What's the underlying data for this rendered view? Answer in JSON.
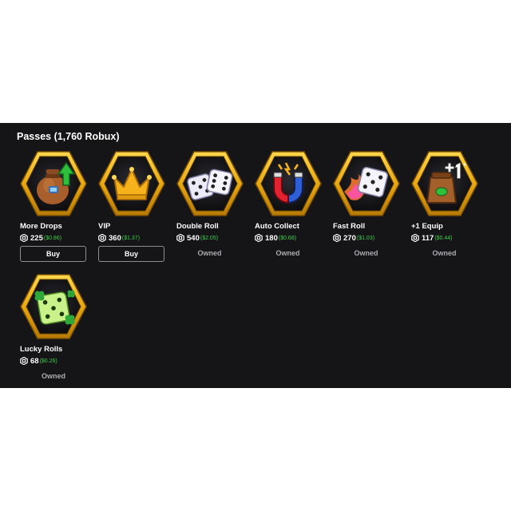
{
  "header": {
    "title": "Passes (1,760 Robux)"
  },
  "colors": {
    "panel_bg": "#151518",
    "gold": "#e8b923",
    "usd_green": "#3ecf4a",
    "owned_gray": "#a9abb0"
  },
  "passes": [
    {
      "name": "More Drops",
      "amount": "225",
      "usd": "($0.86)",
      "status": "Buy",
      "icon": "money-bag-arrow-icon"
    },
    {
      "name": "VIP",
      "amount": "360",
      "usd": "($1.37)",
      "status": "Buy",
      "icon": "crown-icon"
    },
    {
      "name": "Double Roll",
      "amount": "540",
      "usd": "($2.05)",
      "status": "Owned",
      "icon": "two-dice-icon"
    },
    {
      "name": "Auto Collect",
      "amount": "180",
      "usd": "($0.68)",
      "status": "Owned",
      "icon": "magnet-icon"
    },
    {
      "name": "Fast Roll",
      "amount": "270",
      "usd": "($1.03)",
      "status": "Owned",
      "icon": "flaming-die-icon"
    },
    {
      "name": "+1 Equip",
      "amount": "117",
      "usd": "($0.44)",
      "status": "Owned",
      "icon": "bag-plus-one-icon"
    },
    {
      "name": "Lucky Rolls",
      "amount": "68",
      "usd": "($0.26)",
      "status": "Owned",
      "icon": "clover-die-icon"
    }
  ]
}
